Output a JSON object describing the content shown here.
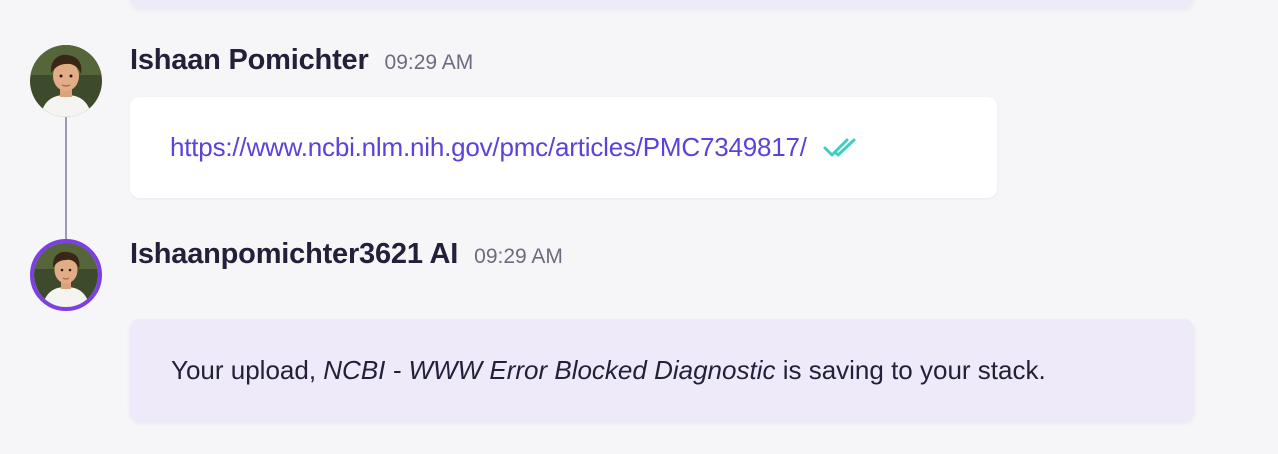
{
  "messages": [
    {
      "author": "Ishaan Pomichter",
      "time": "09:29 AM",
      "link": "https://www.ncbi.nlm.nih.gov/pmc/articles/PMC7349817/",
      "status_icon": "double-check-icon"
    },
    {
      "author": "Ishaanpomichter3621 AI",
      "time": "09:29 AM",
      "text_prefix": "Your upload, ",
      "file_name": "NCBI - WWW Error Blocked Diagnostic",
      "text_suffix": " is saving to your stack."
    }
  ],
  "colors": {
    "link": "#5b43d9",
    "check": "#3fcfc0",
    "ai_ring": "#7b3fe4",
    "ai_bubble": "#eeeaf9",
    "background": "#f6f6f9"
  }
}
